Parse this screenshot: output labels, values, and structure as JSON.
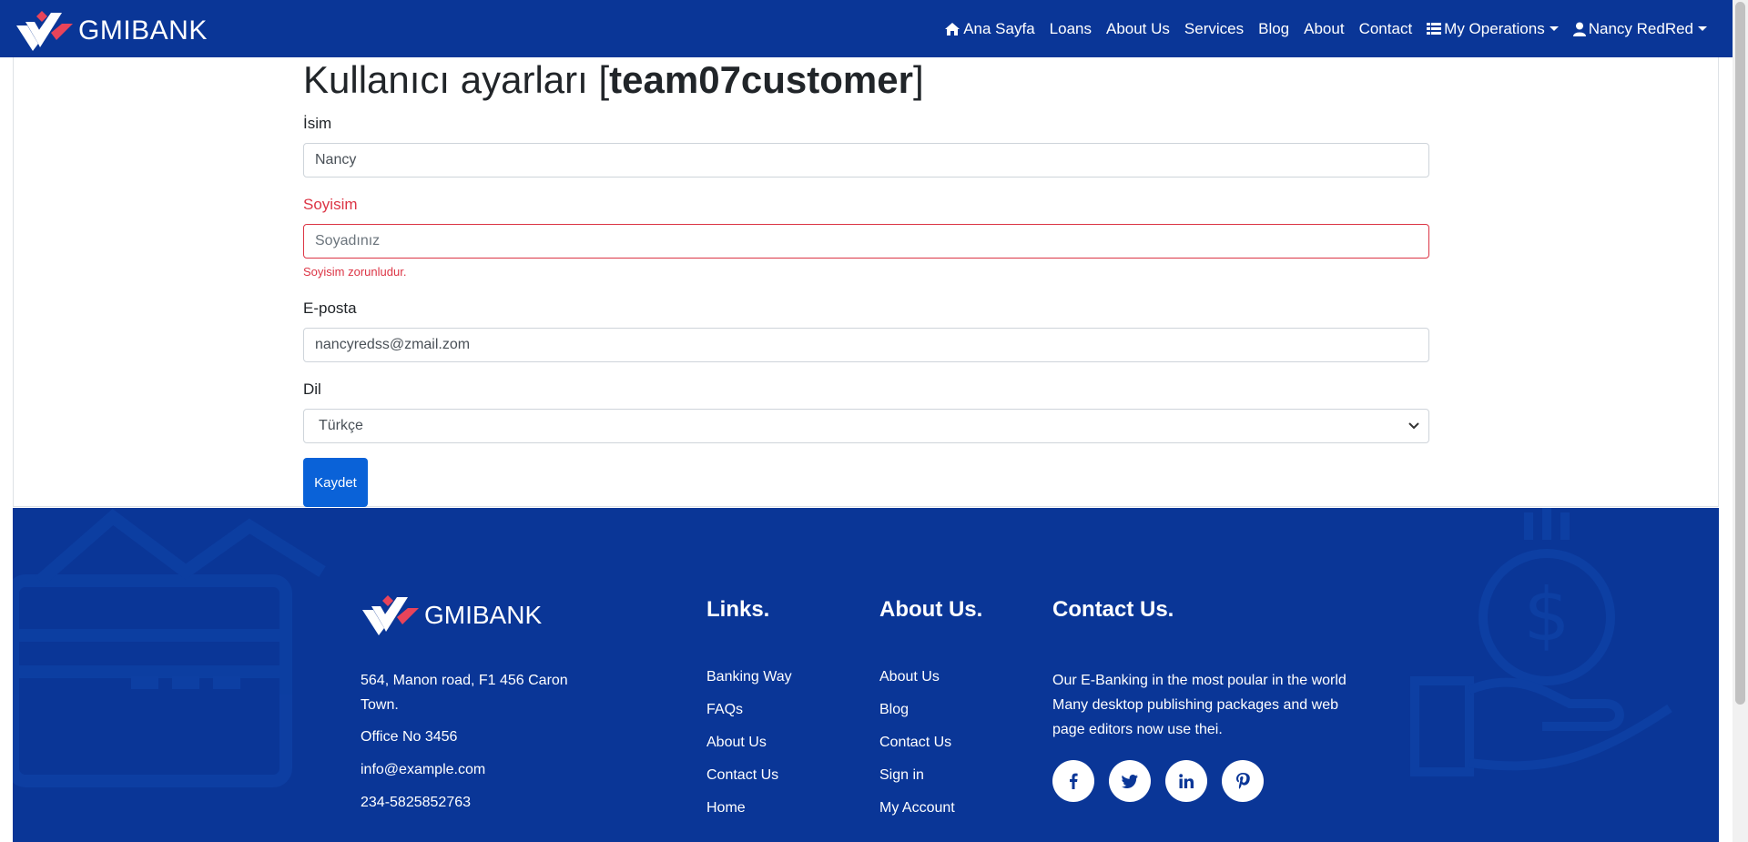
{
  "navbar": {
    "brand": "GMIBANK",
    "items": [
      {
        "label": "Ana Sayfa",
        "icon": "home-icon"
      },
      {
        "label": "Loans"
      },
      {
        "label": "About Us"
      },
      {
        "label": "Services"
      },
      {
        "label": "Blog"
      },
      {
        "label": "About"
      },
      {
        "label": "Contact"
      },
      {
        "label": "My Operations",
        "icon": "list-icon"
      },
      {
        "label": "Nancy RedRed",
        "icon": "user-icon"
      }
    ]
  },
  "settings": {
    "title_prefix": "Kullanıcı ayarları [",
    "title_user": "team07customer",
    "title_suffix": "]",
    "first_name_label": "İsim",
    "first_name_value": "Nancy",
    "last_name_label": "Soyisim",
    "last_name_placeholder": "Soyadınız",
    "last_name_error": "Soyisim zorunludur.",
    "email_label": "E-posta",
    "email_value": "nancyredss@zmail.zom",
    "language_label": "Dil",
    "language_value": "Türkçe",
    "save_label": "Kaydet"
  },
  "footer": {
    "brand": "GMIBANK",
    "address": "564, Manon road, F1 456 Caron Town.",
    "office": "Office No 3456",
    "email": "info@example.com",
    "phone": "234-5825852763",
    "links_heading": "Links.",
    "links": [
      "Banking Way",
      "FAQs",
      "About Us",
      "Contact Us",
      "Home"
    ],
    "about_heading": "About Us.",
    "about_links": [
      "About Us",
      "Blog",
      "Contact Us",
      "Sign in",
      "My Account"
    ],
    "contact_heading": "Contact Us.",
    "contact_text": "Our E-Banking in the most poular in the world Many desktop publishing packages and web page editors now use thei.",
    "social": [
      "facebook-icon",
      "twitter-icon",
      "linkedin-icon",
      "pinterest-icon"
    ]
  },
  "colors": {
    "navy": "#0a3697",
    "primary_button": "#0a62d8",
    "error": "#dc3545",
    "brand_accent": "#e8445a"
  }
}
